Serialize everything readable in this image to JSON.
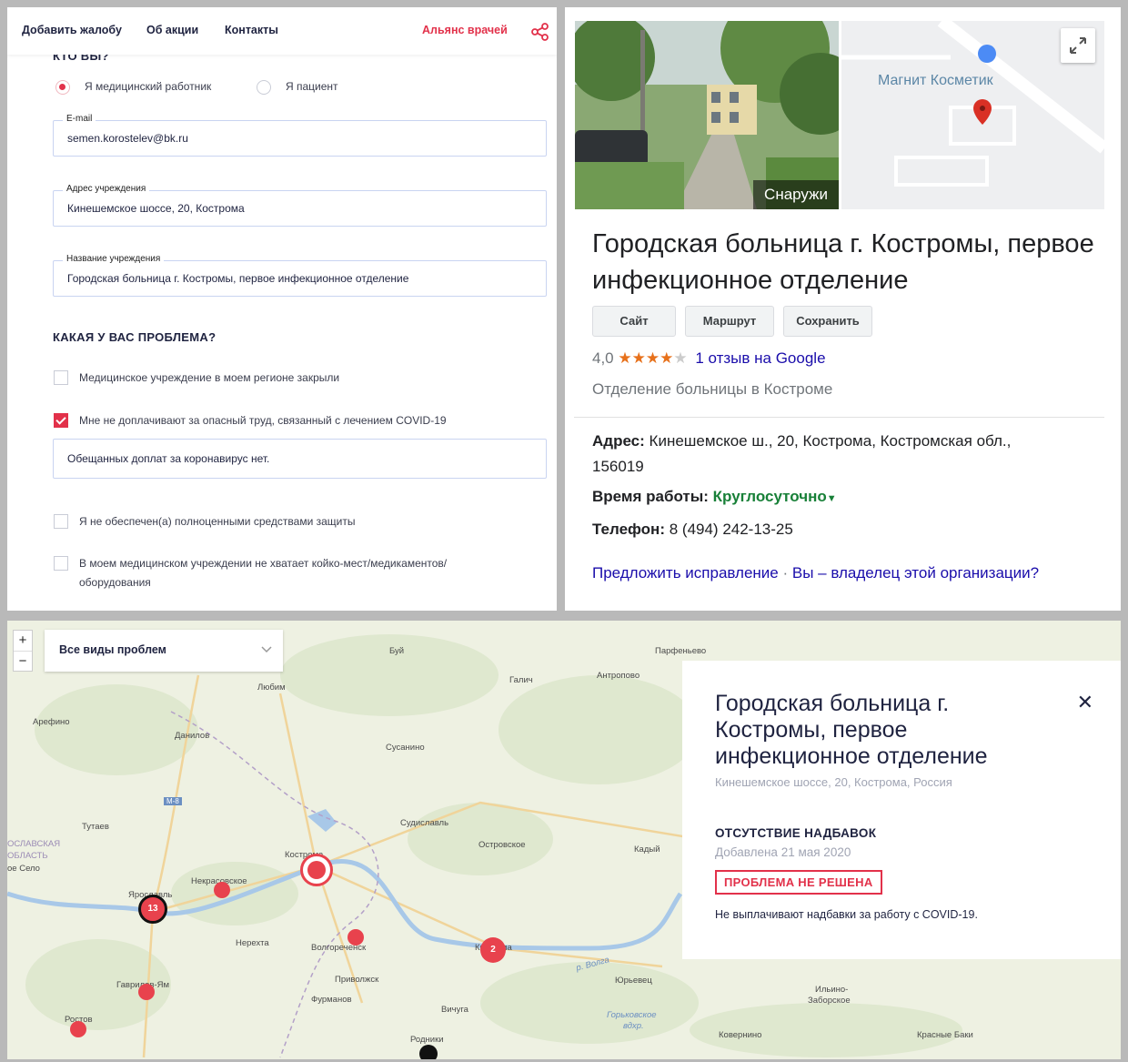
{
  "form": {
    "nav": {
      "complaint": "Добавить жалобу",
      "about": "Об акции",
      "contacts": "Контакты",
      "alliance": "Альянс врачей"
    },
    "who_title": "КТО ВЫ?",
    "roles": [
      {
        "label": "Я медицинский работник",
        "selected": true
      },
      {
        "label": "Я пациент",
        "selected": false
      }
    ],
    "email_label": "E-mail",
    "email_value": "semen.korostelev@bk.ru",
    "address_label": "Адрес учреждения",
    "address_value": "Кинешемское шоссе, 20, Кострома",
    "institution_label": "Название учреждения",
    "institution_value": "Городская больница г. Костромы, первое инфекционное отделение",
    "problem_title": "КАКАЯ У ВАС ПРОБЛЕМА?",
    "problems": [
      {
        "label": "Медицинское учреждение в моем регионе закрыли",
        "checked": false
      },
      {
        "label": "Мне не доплачивают за опасный труд, связанный с лечением COVID-19",
        "checked": true
      },
      {
        "label": "Я не обеспечен(а) полноценными средствами защиты",
        "checked": false
      },
      {
        "label": "В моем медицинском учреждении не хватает койко-мест/медикаментов/",
        "label2": "оборудования",
        "checked": false
      }
    ],
    "problem_comment": "Обещанных доплат за коронавирус нет.",
    "colors": {
      "accent": "#e2314a",
      "navy": "#1f2340"
    }
  },
  "gcard": {
    "photo_label": "Снаружи",
    "map_poi": "Магнит Косметик",
    "title": "Городская больница г. Костромы, первое инфекционное отделение",
    "buttons": [
      "Сайт",
      "Маршрут",
      "Сохранить"
    ],
    "rating": "4,0",
    "stars": "★★★★",
    "star_empty": "★",
    "rating_value": 4,
    "reviews": "1 отзыв на Google",
    "category": "Отделение больницы в Костроме",
    "address_key": "Адрес:",
    "address_val": "Кинешемское ш., 20, Кострома, Костромская обл.,",
    "address_val2": "156019",
    "hours_key": "Время работы:",
    "hours_val": "Круглосуточно",
    "phone_key": "Телефон:",
    "phone_val": "8 (494) 242-13-25",
    "suggest": "Предложить исправление",
    "dot_sep": "·",
    "owner": "Вы – владелец этой организации?"
  },
  "map": {
    "zoom_in": "+",
    "zoom_out": "−",
    "filter": "Все виды проблем",
    "labels": {
      "buy": "Буй",
      "parfenyevo": "Парфеньево",
      "antropovo": "Антропово",
      "galich": "Галич",
      "lyubim": "Любим",
      "arefino": "Арефино",
      "danilov": "Данилов",
      "susanino": "Сусанино",
      "m8": "М-8",
      "tutaev": "Тутаев",
      "sudislavl": "Судиславль",
      "ostrovskoe": "Островское",
      "kady": "Кадый",
      "oblast1": "ОСЛАВСКАЯ",
      "oblast2": "ОБЛАСТЬ",
      "selo": "ое Село",
      "kostroma": "Кострома",
      "nekrasovskoe": "Некрасовское",
      "yaroslavl": "Ярославль",
      "nerekhta": "Нерехта",
      "volgorechensk": "Волгореченск",
      "kineshma": "Кинешма",
      "privolzhsk": "Приволжск",
      "volga": "р. Волга",
      "yuryevets": "Юрьевец",
      "gavrilov": "Гаврилов-Ям",
      "furmanov": "Фурманов",
      "ilyino1": "Ильино-",
      "ilyino2": "Заборское",
      "rostov": "Ростов",
      "vichuga": "Вичуга",
      "gorkovskoe1": "Горьковское",
      "gorkovskoe2": "вдхр.",
      "koverino": "Ковернино",
      "krasnye": "Красные Баки",
      "rodniki": "Родники"
    },
    "clusters": {
      "yaroslavl": "13",
      "kineshma": "2"
    },
    "popup": {
      "title": "Городская больница г. Костромы, первое инфекционное отделение",
      "address": "Кинешемское шоссе, 20, Кострома, Россия",
      "category": "ОТСУТСТВИЕ НАДБАВОК",
      "added": "Добавлена 21 мая 2020",
      "status": "ПРОБЛЕМА НЕ РЕШЕНА",
      "description": "Не выплачивают надбавки за работу с COVID-19."
    }
  }
}
